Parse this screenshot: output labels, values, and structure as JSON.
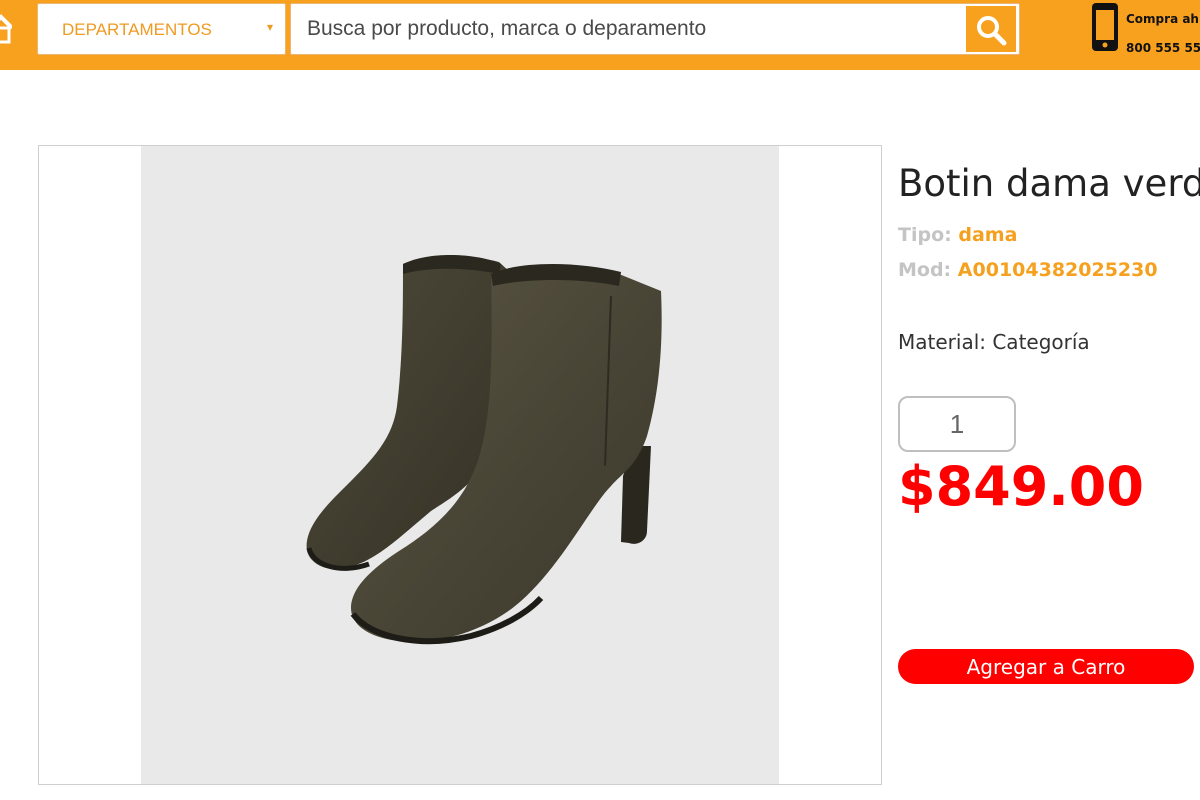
{
  "header": {
    "departments_label": "DEPARTAMENTOS",
    "departments_caret": "▾",
    "search_placeholder": "Busca por producto, marca o deparamento",
    "phone_line1": "Compra ah",
    "phone_line2": "800 555 55"
  },
  "product": {
    "image_icon": "ankle-boot-image",
    "title": "Botin dama verde",
    "tipo_label": "Tipo:",
    "tipo_value": "dama",
    "mod_label": "Mod:",
    "mod_value": "A00104382025230",
    "material": "Material: Categoría",
    "quantity": "1",
    "price": "$849.00",
    "add_to_cart": "Agregar a Carro"
  },
  "colors": {
    "brand_orange": "#f7a11f",
    "price_red": "#ff0000",
    "label_gray": "#c4c4c4"
  }
}
